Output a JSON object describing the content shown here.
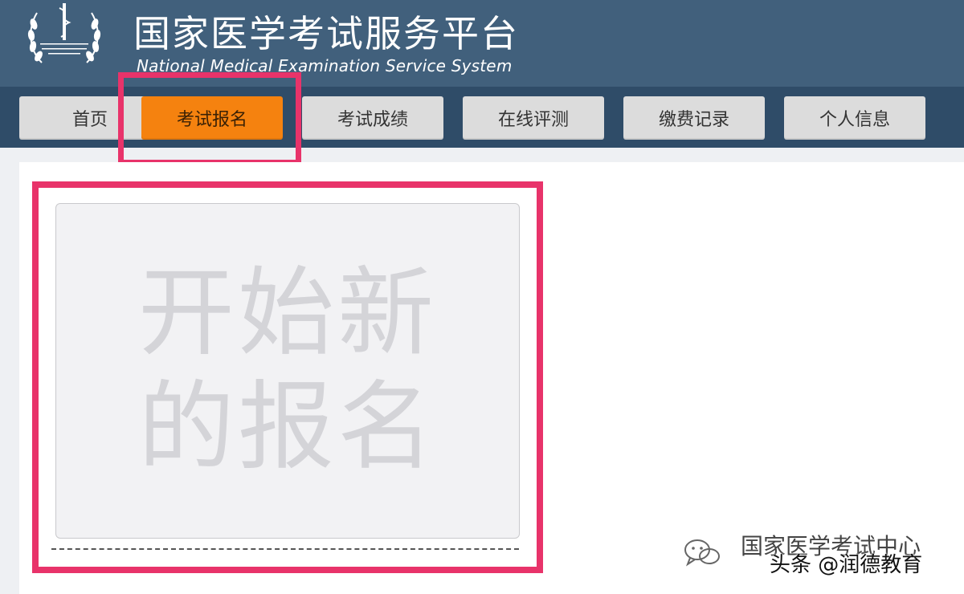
{
  "header": {
    "title": "国家医学考试服务平台",
    "subtitle": "National Medical Examination Service System"
  },
  "nav": {
    "items": [
      {
        "label": "首页"
      },
      {
        "label": "考试报名",
        "active": true
      },
      {
        "label": "考试成绩"
      },
      {
        "label": "在线评测"
      },
      {
        "label": "缴费记录"
      },
      {
        "label": "个人信息"
      }
    ]
  },
  "main": {
    "new_registration_label": "开始新的报名"
  },
  "watermark": {
    "source": "国家医学考试中心",
    "credit": "头条 @润德教育"
  },
  "colors": {
    "header_bg": "#41607c",
    "nav_bg": "#2f4c68",
    "active_tab": "#f5820f",
    "highlight": "#e8336a"
  }
}
